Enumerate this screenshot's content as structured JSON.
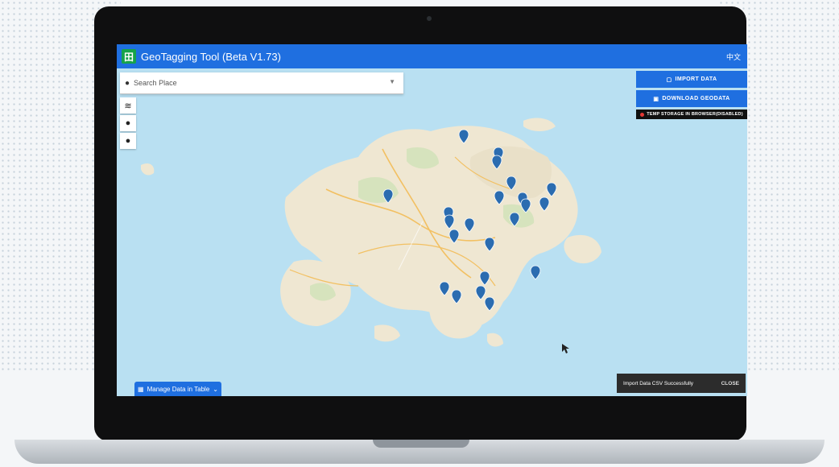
{
  "app": {
    "title": "GeoTagging Tool (Beta V1.73)",
    "logo_glyph": "田",
    "header_right": "中文"
  },
  "search": {
    "placeholder": "Search Place"
  },
  "side_tools": [
    {
      "name": "layers-icon",
      "glyph": "≋"
    },
    {
      "name": "location-pin-icon",
      "glyph": "📍"
    },
    {
      "name": "location-pin-icon-2",
      "glyph": "📍"
    }
  ],
  "panel": {
    "import_label": "IMPORT DATA",
    "download_label": "DOWNLOAD GEODATA",
    "storage_label": "TEMP STORAGE IN BROWSER(DISABLED)"
  },
  "manage_button": {
    "label": "Manage Data in Table",
    "chevron": "⌄"
  },
  "toast": {
    "message": "Import Data CSV Successfully",
    "close_label": "CLOSE"
  },
  "colors": {
    "accent": "#1f6fe0",
    "sea": "#b9e0f2",
    "land": "#efe7d2",
    "pin": "#2b6cb0"
  }
}
